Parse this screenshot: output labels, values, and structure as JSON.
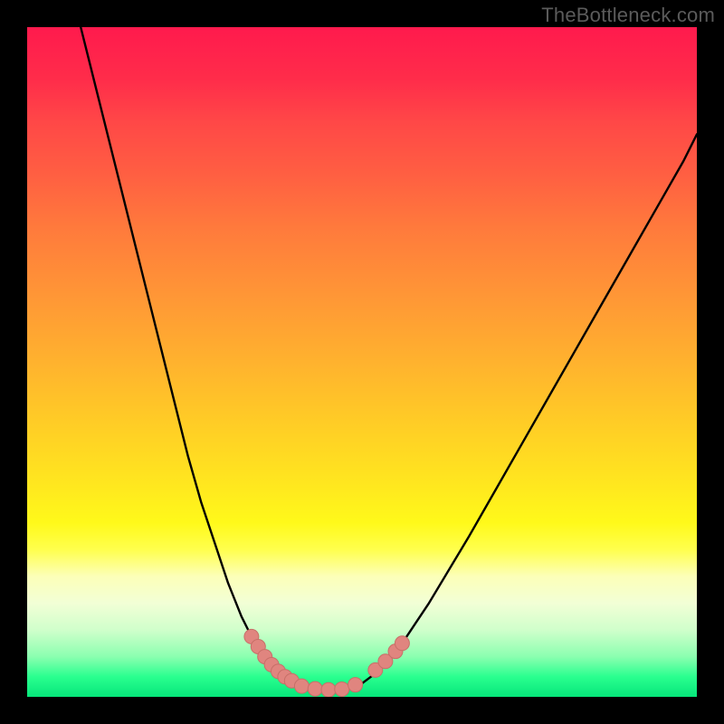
{
  "watermark": "TheBottleneck.com",
  "colors": {
    "background": "#000000",
    "curve": "#000000",
    "marker_fill": "#e0857f",
    "marker_stroke": "#c76f68"
  },
  "chart_data": {
    "type": "line",
    "title": "",
    "xlabel": "",
    "ylabel": "",
    "xlim": [
      0,
      100
    ],
    "ylim": [
      0,
      100
    ],
    "series": [
      {
        "name": "left-branch",
        "x": [
          8,
          10,
          12,
          14,
          16,
          18,
          20,
          22,
          24,
          26,
          28,
          30,
          32,
          33,
          34,
          35,
          36,
          37,
          38,
          39,
          40,
          41
        ],
        "y": [
          100,
          92,
          84,
          76,
          68,
          60,
          52,
          44,
          36,
          29,
          23,
          17,
          12,
          10,
          8,
          6.5,
          5,
          4,
          3,
          2.2,
          1.7,
          1.4
        ]
      },
      {
        "name": "valley-floor",
        "x": [
          41,
          42,
          43,
          44,
          45,
          46,
          47,
          48,
          49,
          50
        ],
        "y": [
          1.4,
          1.2,
          1.05,
          1.0,
          1.0,
          1.0,
          1.05,
          1.2,
          1.5,
          2.0
        ]
      },
      {
        "name": "right-branch",
        "x": [
          50,
          52,
          54,
          56,
          58,
          60,
          63,
          66,
          70,
          74,
          78,
          82,
          86,
          90,
          94,
          98,
          100
        ],
        "y": [
          2.0,
          3.5,
          5.5,
          8,
          11,
          14,
          19,
          24,
          31,
          38,
          45,
          52,
          59,
          66,
          73,
          80,
          84
        ]
      }
    ],
    "markers": [
      {
        "x": 33.5,
        "y": 9
      },
      {
        "x": 34.5,
        "y": 7.5
      },
      {
        "x": 35.5,
        "y": 6
      },
      {
        "x": 36.5,
        "y": 4.8
      },
      {
        "x": 37.5,
        "y": 3.8
      },
      {
        "x": 38.5,
        "y": 3.0
      },
      {
        "x": 39.5,
        "y": 2.4
      },
      {
        "x": 41,
        "y": 1.6
      },
      {
        "x": 43,
        "y": 1.2
      },
      {
        "x": 45,
        "y": 1.05
      },
      {
        "x": 47,
        "y": 1.15
      },
      {
        "x": 49,
        "y": 1.8
      },
      {
        "x": 52,
        "y": 4.0
      },
      {
        "x": 53.5,
        "y": 5.3
      },
      {
        "x": 55,
        "y": 6.8
      },
      {
        "x": 56,
        "y": 8.0
      }
    ]
  }
}
